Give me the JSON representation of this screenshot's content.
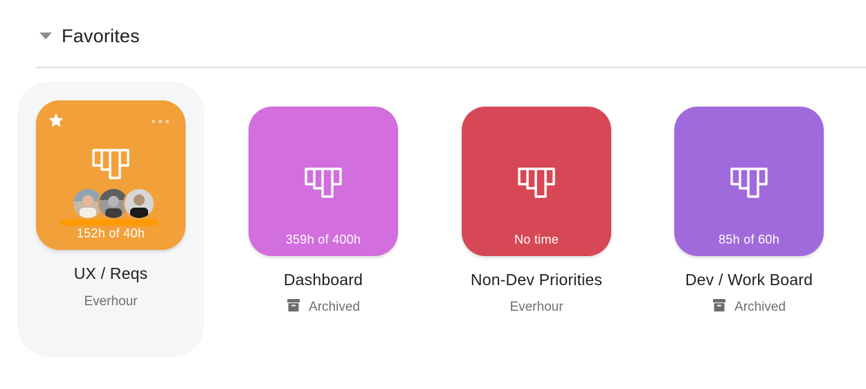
{
  "section": {
    "title": "Favorites",
    "toggle_icon": "caret-down-icon"
  },
  "projects": [
    {
      "name": "UX / Reqs",
      "hours": "152h of 40h",
      "subtitle": "Everhour",
      "archived": false,
      "favorite": true,
      "color": "#f1a03a",
      "icon": "board-icon",
      "progress_bar_color": "#ff9a00",
      "members": [
        "avatar",
        "avatar",
        "avatar"
      ]
    },
    {
      "name": "Dashboard",
      "hours": "359h of 400h",
      "subtitle": "Archived",
      "archived": true,
      "color": "#d26edd",
      "icon": "board-icon"
    },
    {
      "name": "Non-Dev Priorities",
      "hours": "No time",
      "subtitle": "Everhour",
      "archived": false,
      "color": "#d64855",
      "icon": "board-icon"
    },
    {
      "name": "Dev / Work Board",
      "hours": "85h of 60h",
      "subtitle": "Archived",
      "archived": true,
      "color": "#a06adc",
      "icon": "board-icon"
    }
  ]
}
